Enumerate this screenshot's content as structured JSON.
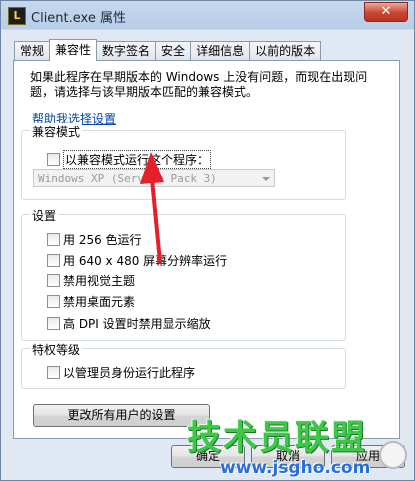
{
  "window": {
    "title": "Client.exe 属性",
    "app_icon_letter": "L",
    "close_glyph": "✕"
  },
  "tabs": [
    {
      "label": "常规"
    },
    {
      "label": "兼容性"
    },
    {
      "label": "数字签名"
    },
    {
      "label": "安全"
    },
    {
      "label": "详细信息"
    },
    {
      "label": "以前的版本"
    }
  ],
  "intro": "如果此程序在早期版本的 Windows 上没有问题，而现在出现问题，请选择与该早期版本匹配的兼容模式。",
  "help_link": "帮助我选择设置",
  "compat_mode": {
    "title": "兼容模式",
    "checkbox_label": "以兼容模式运行这个程序：",
    "checked": false,
    "os_select": "Windows XP (Service Pack 3)"
  },
  "settings": {
    "title": "设置",
    "items": [
      {
        "label": "用 256 色运行",
        "checked": false
      },
      {
        "label": "用 640 x 480 屏幕分辨率运行",
        "checked": false
      },
      {
        "label": "禁用视觉主题",
        "checked": false
      },
      {
        "label": "禁用桌面元素",
        "checked": false
      },
      {
        "label": "高 DPI 设置时禁用显示缩放",
        "checked": false
      }
    ]
  },
  "privilege": {
    "title": "特权等级",
    "checkbox_label": "以管理员身份运行此程序",
    "checked": false
  },
  "all_users_button": "更改所有用户的设置",
  "footer": {
    "ok": "确定",
    "cancel": "取消",
    "apply": "应用"
  },
  "watermark": {
    "text": "技术员联盟",
    "url": "www.jsgho.com"
  },
  "colors": {
    "arrow": "#e4202b",
    "link": "#0645ad",
    "watermark_green": "#3fc74a",
    "watermark_blue": "#2a6fd6"
  }
}
